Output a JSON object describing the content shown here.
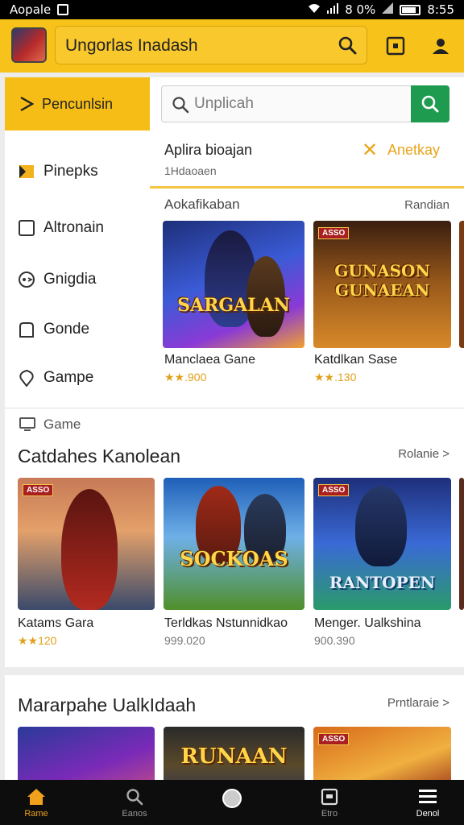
{
  "status_bar": {
    "carrier": "Aopale",
    "battery_text": "8 0%",
    "time": "8:55"
  },
  "header": {
    "title": "Ungorlas Inadash"
  },
  "categories": [
    {
      "label": "Pencunlsin",
      "active": true
    },
    {
      "label": "Pinepks"
    },
    {
      "label": "Altronain"
    },
    {
      "label": "Gnigdia"
    },
    {
      "label": "Gonde"
    },
    {
      "label": "Gampe"
    }
  ],
  "search": {
    "placeholder": "Unplicah"
  },
  "filter": {
    "title": "Aplira bioajan",
    "subtitle": "1Hdaoaen",
    "action": "Anetkay"
  },
  "section1": {
    "title": "Aokafikaban",
    "more": "Randian",
    "cards": [
      {
        "name": "Manclaea Gane",
        "rating": "★★.900",
        "logo": "SARGALAN"
      },
      {
        "name": "Katdlkan Sase",
        "rating": "★★.130",
        "logo": "GUNASON GUNAEAN",
        "badge": "ASSO"
      }
    ]
  },
  "game_label": "Game",
  "section2": {
    "title": "Catdahes Kanolean",
    "more": "Rolanie >",
    "cards": [
      {
        "name": "Katams Gara",
        "rating": "★★120",
        "badge": "ASSO"
      },
      {
        "name": "Terldkas Nstunnidkao",
        "rating": "999.020",
        "logo": "SOCKOAS"
      },
      {
        "name": "Menger. Ualkshina",
        "rating": "900.390",
        "logo": "RANTOPEN",
        "badge": "ASSO"
      }
    ]
  },
  "section3": {
    "title": "Mararpahe UalkIdaah",
    "more": "Prntlaraie >",
    "cards": [
      {
        "logo": ""
      },
      {
        "logo": "RUNAAN"
      },
      {
        "logo": "",
        "badge": "ASSO"
      }
    ]
  },
  "bottom_nav": [
    {
      "label": "Rame",
      "active": true
    },
    {
      "label": "Eanos"
    },
    {
      "label": ""
    },
    {
      "label": "Etro"
    },
    {
      "label": "Denol"
    }
  ],
  "colors": {
    "accent": "#f7c21a",
    "search_button": "#1f9b4f",
    "action_text": "#e8a419"
  }
}
